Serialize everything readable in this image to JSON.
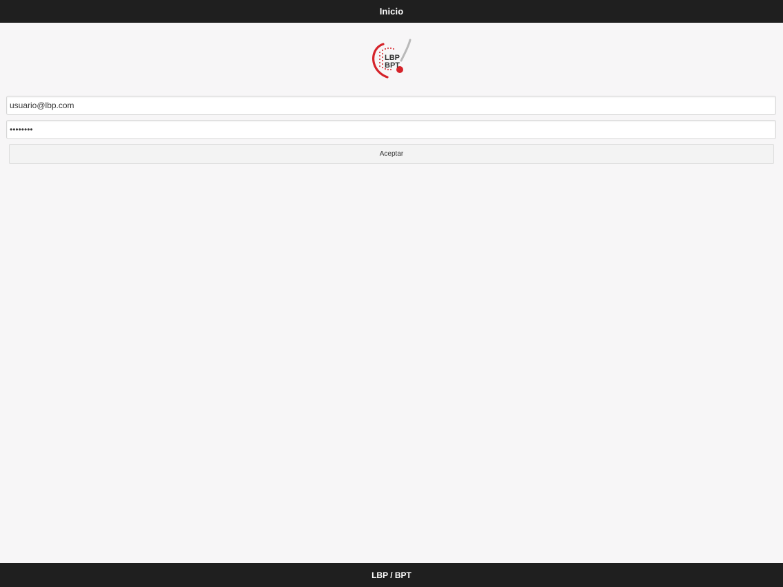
{
  "header": {
    "title": "Inicio"
  },
  "logo": {
    "text_top": "LBP",
    "text_bottom": "BPT",
    "accent": "#d5232a"
  },
  "login": {
    "email_value": "usuario@lbp.com",
    "password_value": "passwor1",
    "submit_label": "Aceptar"
  },
  "footer": {
    "text": "LBP / BPT"
  },
  "colors": {
    "bar_background": "#1f1f1f",
    "page_background": "#f7f6f7",
    "accent_red": "#d5232a"
  }
}
